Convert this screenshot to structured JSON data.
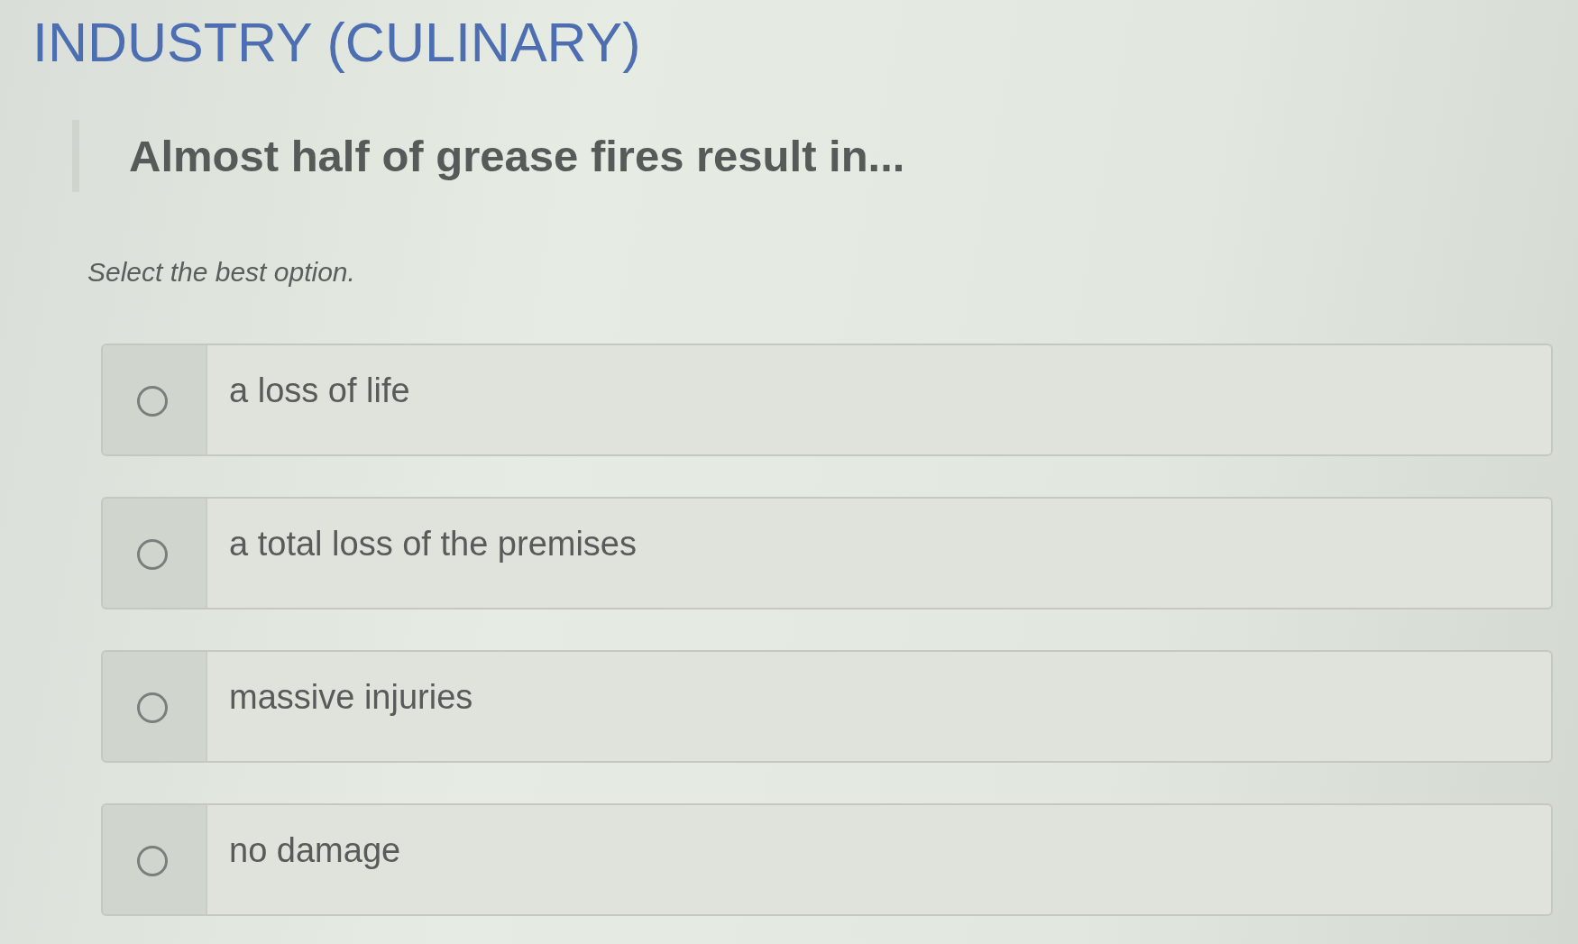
{
  "course": {
    "title": "INDUSTRY (CULINARY)"
  },
  "question": {
    "text": "Almost half of grease fires result in...",
    "instruction": "Select the best option."
  },
  "options": [
    {
      "label": "a loss of life",
      "selected": false
    },
    {
      "label": "a total loss of the premises",
      "selected": false
    },
    {
      "label": "massive injuries",
      "selected": false
    },
    {
      "label": "no damage",
      "selected": false
    }
  ]
}
